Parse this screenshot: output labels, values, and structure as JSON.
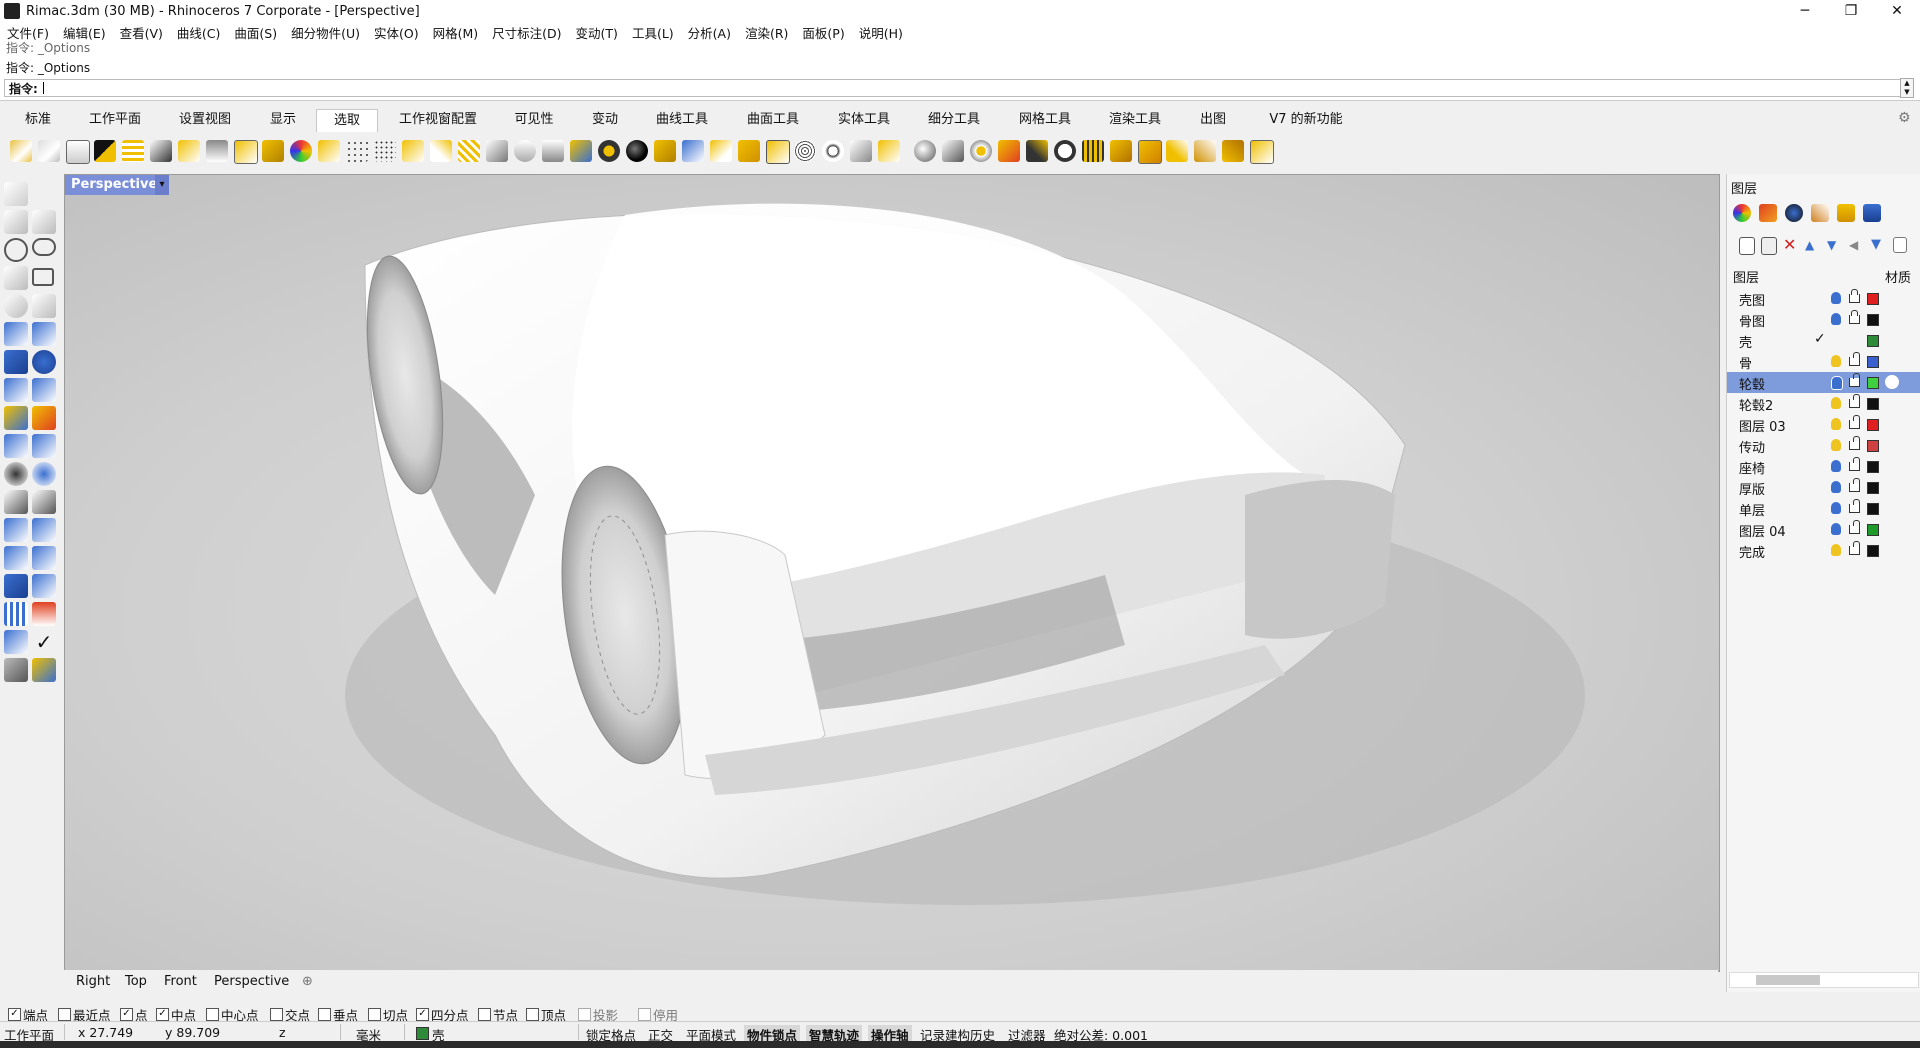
{
  "window": {
    "title": "Rimac.3dm (30 MB) - Rhinoceros 7 Corporate - [Perspective]",
    "minimize": "─",
    "maximize": "❐",
    "close": "✕"
  },
  "menu": [
    "文件(F)",
    "编辑(E)",
    "查看(V)",
    "曲线(C)",
    "曲面(S)",
    "细分物件(U)",
    "实体(O)",
    "网格(M)",
    "尺寸标注(D)",
    "变动(T)",
    "工具(L)",
    "分析(A)",
    "渲染(R)",
    "面板(P)",
    "说明(H)"
  ],
  "command": {
    "history": [
      "指令: _Options",
      "指令: _Options"
    ],
    "prompt": "指令:",
    "value": ""
  },
  "tabs": [
    "标准",
    "工作平面",
    "设置视图",
    "显示",
    "选取",
    "工作视窗配置",
    "可见性",
    "变动",
    "曲线工具",
    "曲面工具",
    "实体工具",
    "细分工具",
    "网格工具",
    "渲染工具",
    "出图",
    "V7 的新功能"
  ],
  "active_tab": "选取",
  "viewport": {
    "label": "Perspective",
    "dropdown": "▾"
  },
  "viewport_tabs": [
    "Right",
    "Top",
    "Front",
    "Perspective",
    "⊕"
  ],
  "layers": {
    "panel_title": "图层",
    "col_name": "图层",
    "col_material": "材质",
    "rows": [
      {
        "name": "壳图",
        "bulb": "#3a6fd0",
        "color": "#e02020",
        "lock": "locked"
      },
      {
        "name": "骨图",
        "bulb": "#3a6fd0",
        "color": "#111111",
        "lock": "locked"
      },
      {
        "name": "壳",
        "bulb": "",
        "color": "#2e8b3a",
        "lock": "none",
        "current": true
      },
      {
        "name": "骨",
        "bulb": "#f0c420",
        "color": "#3a5fcf",
        "lock": "open"
      },
      {
        "name": "轮毂",
        "bulb": "#3a6fd0",
        "color": "#3fcf3f",
        "lock": "open",
        "selected": true
      },
      {
        "name": "轮毂2",
        "bulb": "#f0c420",
        "color": "#111111",
        "lock": "open"
      },
      {
        "name": "图层 03",
        "bulb": "#f0c420",
        "color": "#e02020",
        "lock": "open"
      },
      {
        "name": "传动",
        "bulb": "#f0c420",
        "color": "#cf4040",
        "lock": "open"
      },
      {
        "name": "座椅",
        "bulb": "#3a6fd0",
        "color": "#111111",
        "lock": "open"
      },
      {
        "name": "厚版",
        "bulb": "#3a6fd0",
        "color": "#111111",
        "lock": "open"
      },
      {
        "name": "单层",
        "bulb": "#3a6fd0",
        "color": "#111111",
        "lock": "open"
      },
      {
        "name": "图层 04",
        "bulb": "#3a6fd0",
        "color": "#1f9a2a",
        "lock": "open"
      },
      {
        "name": "完成",
        "bulb": "#f0c420",
        "color": "#111111",
        "lock": "open"
      }
    ],
    "current_mark": "✓"
  },
  "osnaps": [
    {
      "label": "端点",
      "checked": true
    },
    {
      "label": "最近点",
      "checked": false
    },
    {
      "label": "点",
      "checked": true
    },
    {
      "label": "中点",
      "checked": true
    },
    {
      "label": "中心点",
      "checked": false
    },
    {
      "label": "交点",
      "checked": false
    },
    {
      "label": "垂点",
      "checked": false
    },
    {
      "label": "切点",
      "checked": false
    },
    {
      "label": "四分点",
      "checked": true
    },
    {
      "label": "节点",
      "checked": false
    },
    {
      "label": "顶点",
      "checked": false
    },
    {
      "label": "投影",
      "checked": false,
      "disabled": true
    },
    {
      "label": "停用",
      "checked": false,
      "disabled": true
    }
  ],
  "status": {
    "cplane": "工作平面",
    "x": "x 27.749",
    "y": "y 89.709",
    "z": "z",
    "units": "毫米",
    "layer": "壳",
    "layer_color": "#2e8b3a",
    "grid_snap": "锁定格点",
    "ortho": "正交",
    "planar": "平面模式",
    "osnap": "物件锁点",
    "smarttrack": "智慧轨迹",
    "gumball": "操作轴",
    "history": "记录建构历史",
    "filter": "过滤器",
    "tolerance": "绝对公差: 0.001"
  }
}
